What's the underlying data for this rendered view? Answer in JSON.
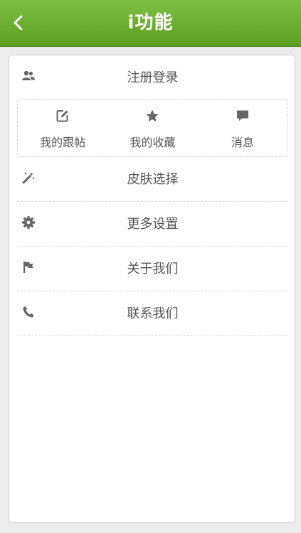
{
  "header": {
    "title": "i功能",
    "back_icon": "chevron-left-icon",
    "background_color": "#6aaf2f"
  },
  "menu": {
    "register_login": {
      "label": "注册登录",
      "icon": "users-icon"
    },
    "quick_actions": [
      {
        "label": "我的跟帖",
        "icon": "edit-icon"
      },
      {
        "label": "我的收藏",
        "icon": "star-icon"
      },
      {
        "label": "消息",
        "icon": "message-icon"
      }
    ],
    "items": [
      {
        "label": "皮肤选择",
        "icon": "magic-wand-icon"
      },
      {
        "label": "更多设置",
        "icon": "gear-icon"
      },
      {
        "label": "关于我们",
        "icon": "flag-icon"
      },
      {
        "label": "联系我们",
        "icon": "phone-icon"
      }
    ]
  }
}
